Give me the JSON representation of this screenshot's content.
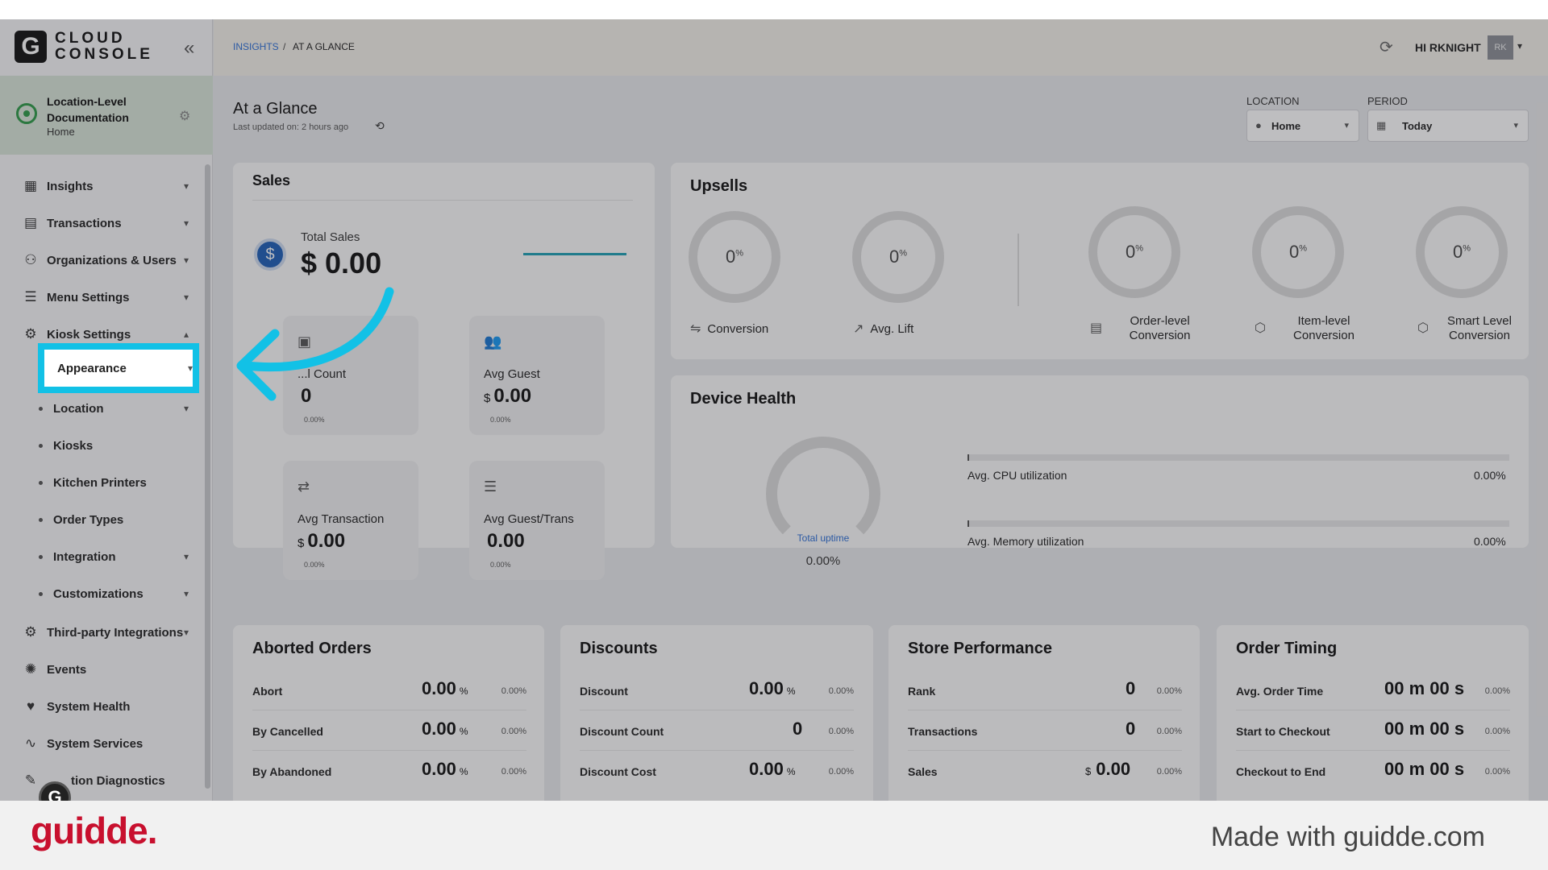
{
  "brand": {
    "logo_letter": "G",
    "logo_line1": "CLOUD",
    "logo_line2": "CONSOLE"
  },
  "location_card": {
    "name": "Location-Level Documentation",
    "subtitle": "Home"
  },
  "sidebar": {
    "items": [
      {
        "label": "Insights"
      },
      {
        "label": "Transactions"
      },
      {
        "label": "Organizations & Users"
      },
      {
        "label": "Menu Settings"
      },
      {
        "label": "Kiosk Settings"
      }
    ],
    "kiosk_sub": [
      {
        "label": "Appearance"
      },
      {
        "label": "Location"
      },
      {
        "label": "Kiosks"
      },
      {
        "label": "Kitchen Printers"
      },
      {
        "label": "Order Types"
      },
      {
        "label": "Integration"
      },
      {
        "label": "Customizations"
      }
    ],
    "items_after": [
      {
        "label": "Third-party Integrations"
      },
      {
        "label": "Events"
      },
      {
        "label": "System Health"
      },
      {
        "label": "System Services"
      },
      {
        "label": "tion Diagnostics"
      }
    ]
  },
  "header": {
    "breadcrumb_root": "INSIGHTS",
    "breadcrumb_sep": "/",
    "breadcrumb_current": "AT A GLANCE",
    "user_greeting": "HI RKNIGHT",
    "avatar_initials": "RK"
  },
  "page": {
    "title": "At a Glance",
    "last_updated": "Last updated on: 2 hours ago"
  },
  "filters": {
    "location": {
      "label": "LOCATION",
      "value": "Home"
    },
    "period": {
      "label": "PERIOD",
      "value": "Today"
    }
  },
  "sales": {
    "title": "Sales",
    "total_label": "Total Sales",
    "total_value": "$ 0.00",
    "tiles": [
      {
        "label": "...l Count",
        "currency": "",
        "value": "0",
        "pct": "0.00%"
      },
      {
        "label": "Avg Guest",
        "currency": "$",
        "value": "0.00",
        "pct": "0.00%"
      },
      {
        "label": "Avg Transaction",
        "currency": "$",
        "value": "0.00",
        "pct": "0.00%"
      },
      {
        "label": "Avg Guest/Trans",
        "currency": "",
        "value": "0.00",
        "pct": "0.00%"
      }
    ]
  },
  "upsells": {
    "title": "Upsells",
    "rings": [
      {
        "value": "0",
        "unit": "%",
        "caption": "Conversion"
      },
      {
        "value": "0",
        "unit": "%",
        "caption": "Avg. Lift"
      },
      {
        "value": "0",
        "unit": "%",
        "caption": "Order-level Conversion"
      },
      {
        "value": "0",
        "unit": "%",
        "caption": "Item-level Conversion"
      },
      {
        "value": "0",
        "unit": "%",
        "caption": "Smart Level Conversion"
      }
    ]
  },
  "device_health": {
    "title": "Device Health",
    "uptime_label": "Total uptime",
    "uptime_value": "0.00%",
    "cpu_label": "Avg. CPU utilization",
    "cpu_value": "0.00%",
    "mem_label": "Avg. Memory utilization",
    "mem_value": "0.00%"
  },
  "aborted_orders": {
    "title": "Aborted Orders",
    "rows": [
      {
        "label": "Abort",
        "value": "0.00",
        "unit": "%",
        "pct": "0.00%"
      },
      {
        "label": "By Cancelled",
        "value": "0.00",
        "unit": "%",
        "pct": "0.00%"
      },
      {
        "label": "By Abandoned",
        "value": "0.00",
        "unit": "%",
        "pct": "0.00%"
      }
    ]
  },
  "discounts": {
    "title": "Discounts",
    "rows": [
      {
        "label": "Discount",
        "value": "0.00",
        "unit": "%",
        "pct": "0.00%"
      },
      {
        "label": "Discount Count",
        "value": "0",
        "unit": "",
        "pct": "0.00%"
      },
      {
        "label": "Discount Cost",
        "value": "0.00",
        "unit": "%",
        "pct": "0.00%"
      }
    ]
  },
  "store_performance": {
    "title": "Store Performance",
    "rows": [
      {
        "label": "Rank",
        "pre": "",
        "value": "0",
        "pct": "0.00%"
      },
      {
        "label": "Transactions",
        "pre": "",
        "value": "0",
        "pct": "0.00%"
      },
      {
        "label": "Sales",
        "pre": "$",
        "value": "0.00",
        "pct": "0.00%"
      }
    ]
  },
  "order_timing": {
    "title": "Order Timing",
    "rows": [
      {
        "label": "Avg. Order Time",
        "value": "00 m 00 s",
        "pct": "0.00%"
      },
      {
        "label": "Start to Checkout",
        "value": "00 m 00 s",
        "pct": "0.00%"
      },
      {
        "label": "Checkout to End",
        "value": "00 m 00 s",
        "pct": "0.00%"
      }
    ]
  },
  "footer": {
    "logo": "guidde.",
    "made_with": "Made with guidde.com"
  },
  "colors": {
    "highlight": "#12c1e6",
    "accent_blue": "#2d6fd6",
    "brand_red": "#c8102e",
    "location_green": "#2e9b48"
  }
}
